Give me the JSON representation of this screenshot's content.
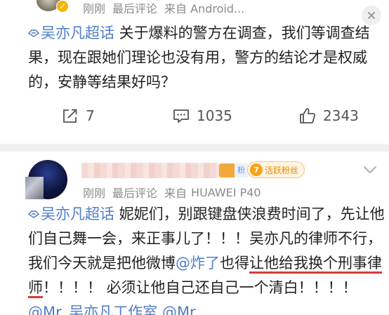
{
  "post1": {
    "meta": {
      "time": "刚刚",
      "sort": "最后评论",
      "source": "来自 Android..."
    },
    "topic": "吴亦凡超话",
    "text": " 关于爆料的警方在调查，我们等调查结果，现在跟她们理论也没有用，警方的结论才是权威的，安静等结果好吗？",
    "actions": {
      "share_count": "7",
      "comment_count": "1035",
      "like_count": "2343"
    }
  },
  "post2": {
    "meta": {
      "time": "刚刚",
      "sort": "最后评论",
      "source_prefix": "来自",
      "source_device": "HUAWEI P40"
    },
    "badges": {
      "fan_label": "粉",
      "active_level": "7",
      "active_label": "活跃粉丝"
    },
    "topic": "吴亦凡超话",
    "text_part1": " 妮妮们，别跟键盘侠浪费时间了，先让他们自己舞一会，来正事儿了！！！吴亦凡的律师不行，我们今天就是把他微博",
    "mention1": "@炸了",
    "text_part2": "也得",
    "underlined": "让他给我换个刑事律师",
    "text_part3": "！！！！ 必须让他自己还自己一个清白！！！！ ",
    "mention2": "@Mr_吴亦凡工作室",
    "mention3": " @Mr_"
  },
  "colors": {
    "link": "#4f7cc7",
    "meta": "#8a8a8a",
    "underline": "#d83a3a",
    "badge": "#f7b500"
  },
  "icons": [
    "verified-badge-icon",
    "close-icon",
    "topic-icon",
    "share-icon",
    "comment-icon",
    "like-icon",
    "chevron-down-icon"
  ]
}
